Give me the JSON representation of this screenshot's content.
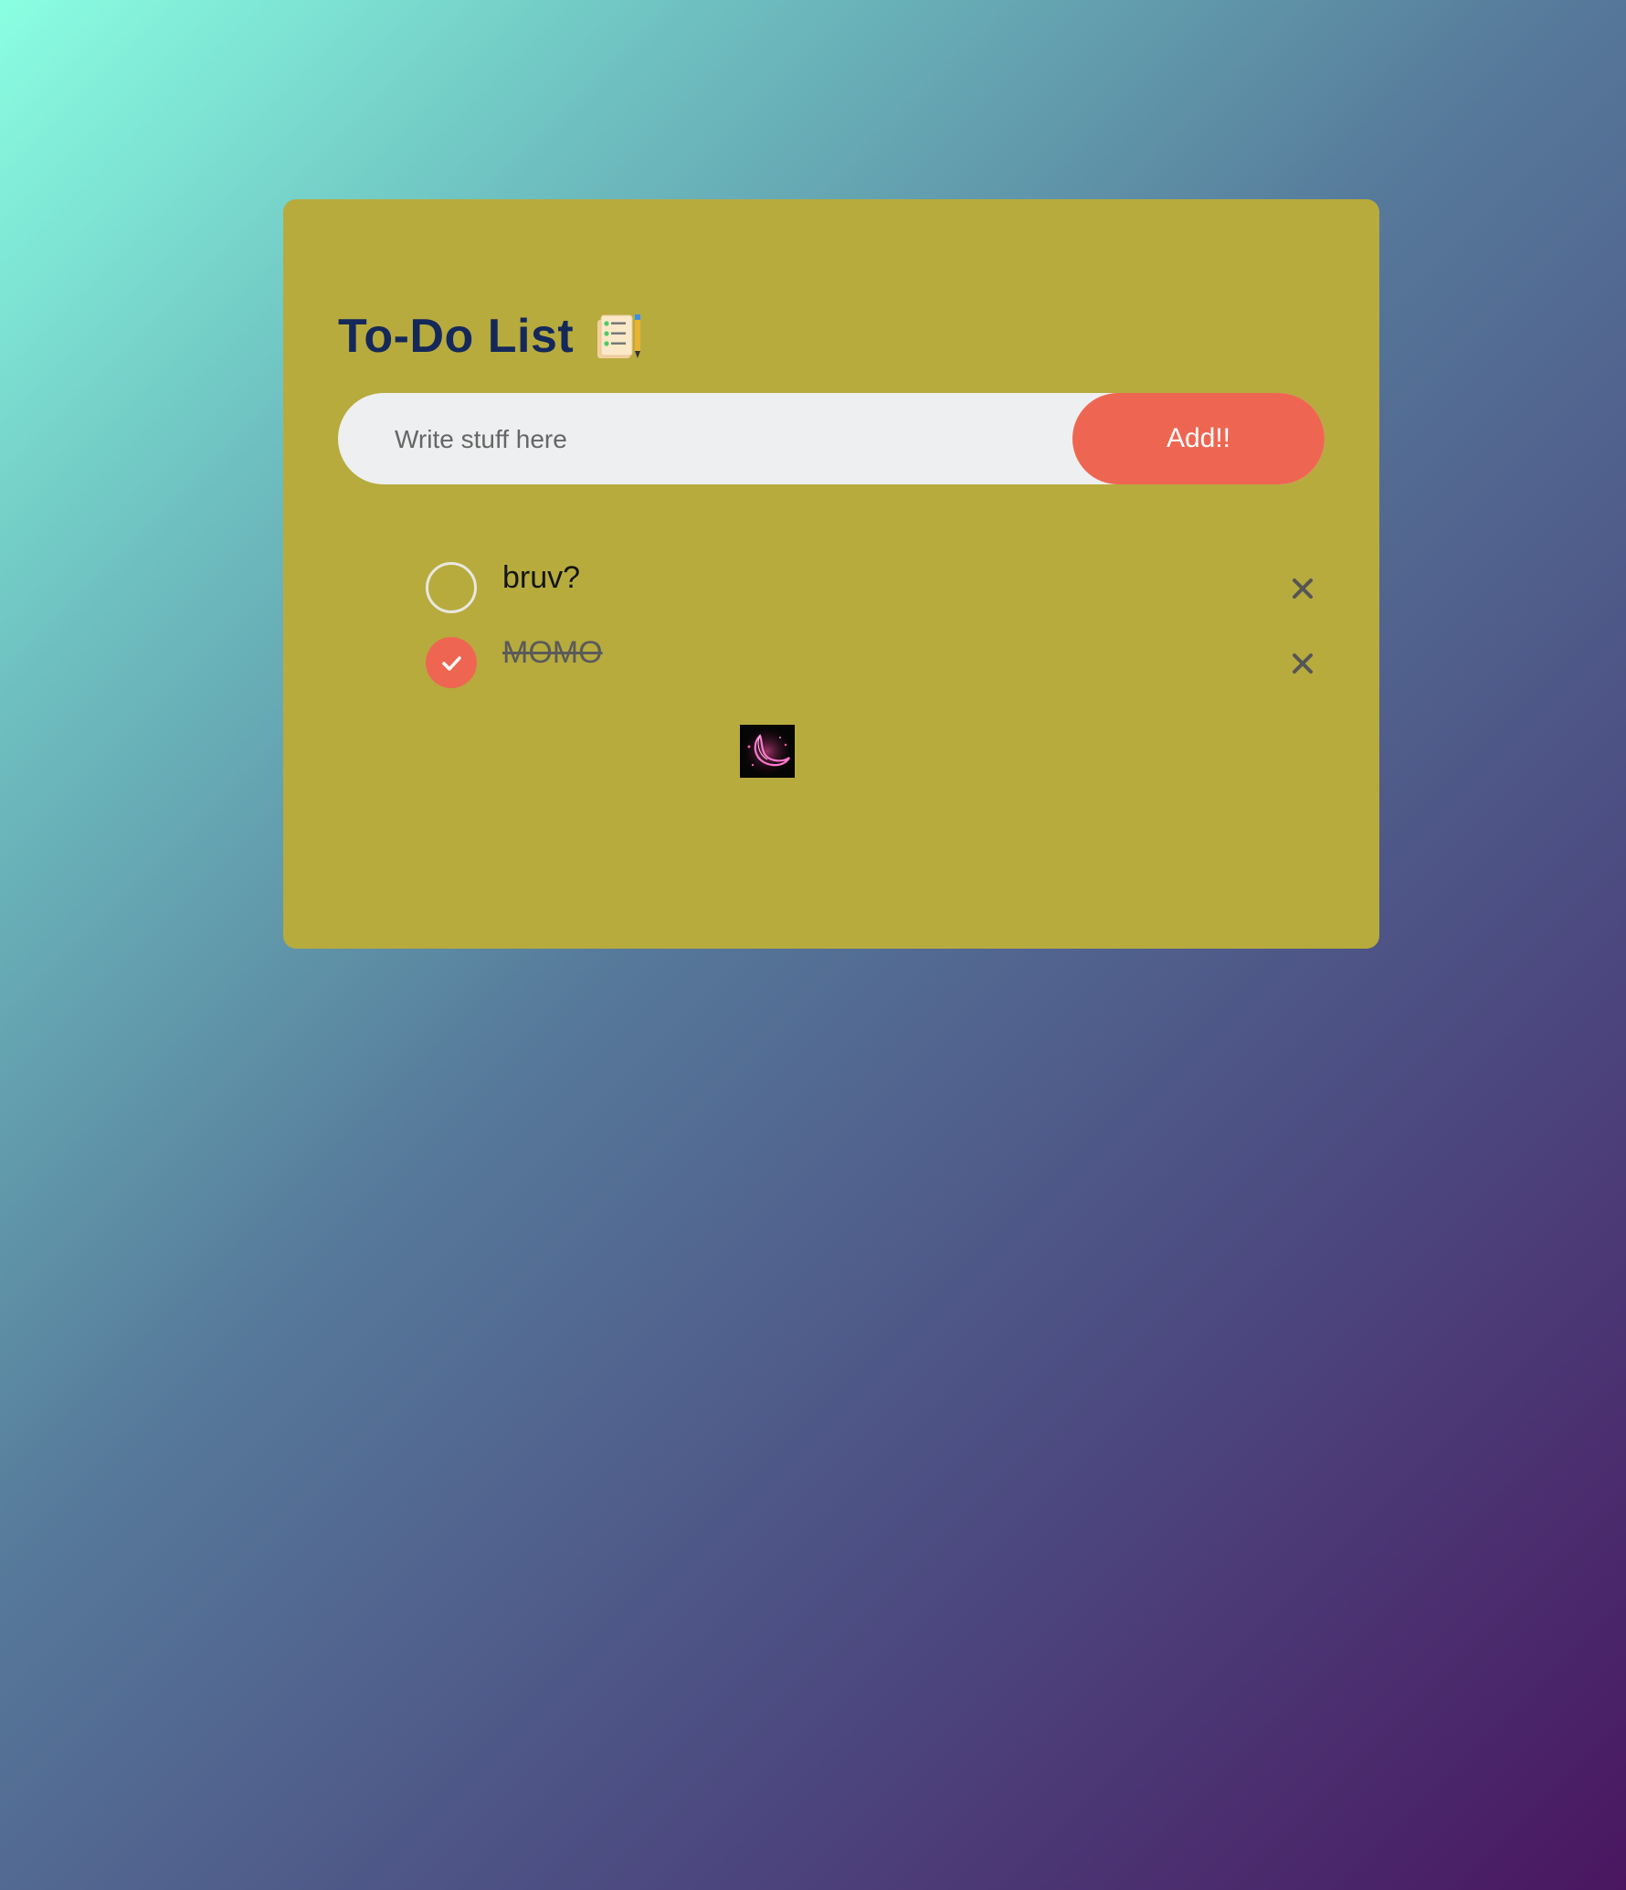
{
  "app": {
    "title": "To-Do List",
    "title_icon": "notepad-checklist-icon"
  },
  "input": {
    "placeholder": "Write stuff here",
    "value": ""
  },
  "add_button": {
    "label": "Add!!"
  },
  "tasks": [
    {
      "text": "bruv?",
      "completed": false,
      "remove_icon": "close-icon"
    },
    {
      "text": "MOMO",
      "completed": true,
      "remove_icon": "close-icon"
    }
  ],
  "thumbnail": {
    "icon": "crescent-moon-neon-icon"
  },
  "colors": {
    "card_background": "#b7ab3e",
    "accent": "#ee6652",
    "title": "#14285a",
    "input_background": "#eeeff0"
  }
}
